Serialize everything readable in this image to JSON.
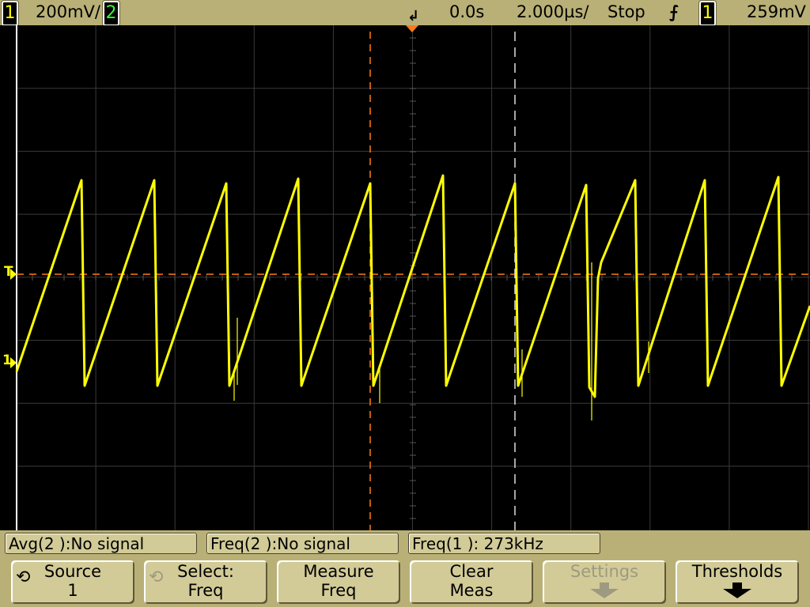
{
  "status_bar": {
    "ch1_label": "1",
    "ch1_scale": "200mV/",
    "ch2_label": "2",
    "time_delay": "0.0s",
    "time_scale": "2.000µs/",
    "run_state": "Stop",
    "trigger_slope_icon": "rising-edge-icon",
    "trigger_source": "1",
    "trigger_level": "259mV"
  },
  "markers": {
    "trigger_level": "T",
    "channel1_ground": "1"
  },
  "measurements": [
    "Avg(2 ):No signal",
    "Freq(2 ):No signal",
    "Freq(1 ): 273kHz"
  ],
  "softkeys": [
    {
      "line1": "Source",
      "line2": "1",
      "icon": "rotate-knob-icon",
      "enabled": true
    },
    {
      "line1": "Select:",
      "line2": "Freq",
      "icon": "rotate-knob-icon",
      "enabled": false
    },
    {
      "line1": "Measure",
      "line2": "Freq",
      "enabled": true
    },
    {
      "line1": "Clear",
      "line2": "Meas",
      "enabled": true
    },
    {
      "line1": "Settings",
      "icon": "down-arrow-icon",
      "enabled": false
    },
    {
      "line1": "Thresholds",
      "icon": "down-arrow-icon",
      "enabled": true
    }
  ],
  "colors": {
    "ch1": "#ffff00",
    "ch2": "#33ff33",
    "cursor": "#ff7a1a",
    "grid": "#3a3a3a",
    "bezel": "#b9b077"
  }
}
